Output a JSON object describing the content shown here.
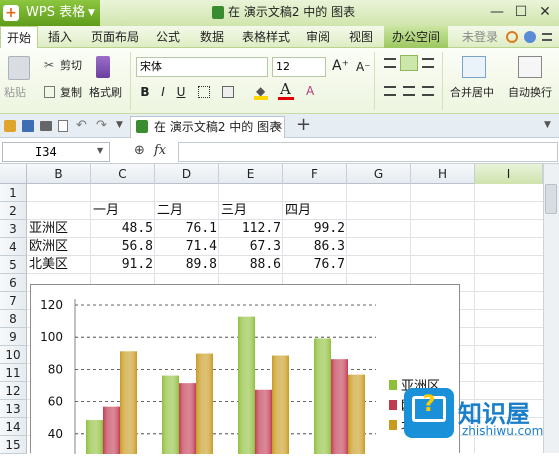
{
  "app": {
    "logo_glyph": "+",
    "name": "WPS 表格",
    "caret": "▼",
    "doc_title": "在 演示文稿2 中的 图表",
    "window_buttons": {
      "minimize": "—",
      "maximize": "☐",
      "close": "✕"
    }
  },
  "menu": {
    "items": [
      "开始",
      "插入",
      "页面布局",
      "公式",
      "数据",
      "表格样式",
      "审阅",
      "视图",
      "办公空间"
    ],
    "login": "未登录"
  },
  "ribbon": {
    "paste": "粘贴",
    "cut": "剪切",
    "copy": "复制",
    "format_painter": "格式刷",
    "font_name": "宋体",
    "font_size": "12",
    "bold": "B",
    "italic": "I",
    "underline": "U",
    "merge_center": "合并居中",
    "wrap_text": "自动换行",
    "grow_font": "A⁺",
    "shrink_font": "A⁻"
  },
  "tabbar": {
    "doc_tab": "在 演示文稿2 中的 图表",
    "close": "✕",
    "add": "+"
  },
  "formula_bar": {
    "name_box": "I34",
    "fx": "fx",
    "value": ""
  },
  "grid": {
    "columns": [
      "B",
      "C",
      "D",
      "E",
      "F",
      "G",
      "H",
      "I"
    ],
    "rows": [
      "1",
      "2",
      "3",
      "4",
      "5",
      "6",
      "7",
      "8",
      "9",
      "10",
      "11",
      "12",
      "13",
      "14",
      "15"
    ],
    "header_row": [
      "一月",
      "二月",
      "三月",
      "四月"
    ],
    "data_rows": [
      {
        "label": "亚洲区",
        "values": [
          "48.5",
          "76.1",
          "112.7",
          "99.2"
        ]
      },
      {
        "label": "欧洲区",
        "values": [
          "56.8",
          "71.4",
          "67.3",
          "86.3"
        ]
      },
      {
        "label": "北美区",
        "values": [
          "91.2",
          "89.8",
          "88.6",
          "76.7"
        ]
      }
    ]
  },
  "chart_data": {
    "type": "bar",
    "categories": [
      "一月",
      "二月",
      "三月",
      "四月"
    ],
    "series": [
      {
        "name": "亚洲区",
        "values": [
          48.5,
          76.1,
          112.7,
          99.2
        ],
        "color": "#8fbf3a"
      },
      {
        "name": "欧洲区",
        "values": [
          56.8,
          71.4,
          67.3,
          86.3
        ],
        "color": "#c23a52"
      },
      {
        "name": "北美区",
        "values": [
          91.2,
          89.8,
          88.6,
          76.7
        ],
        "color": "#c89a1e"
      }
    ],
    "yticks": [
      "120",
      "100",
      "80",
      "60",
      "40"
    ],
    "ylim": [
      0,
      120
    ],
    "grid": "dashed horizontal",
    "legend_placement": "right"
  },
  "watermark": {
    "text": "知识屋",
    "url": "zhishiwu.com",
    "icon_glyph": "?"
  },
  "colors": {
    "accent_green": "#8dc63f",
    "watermark_blue": "#1a90d9"
  }
}
